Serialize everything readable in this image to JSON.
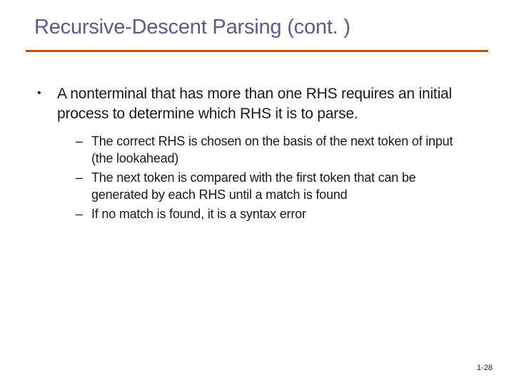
{
  "slide": {
    "title": "Recursive-Descent Parsing (cont. )",
    "bullets": [
      {
        "text": "A nonterminal that has more than one RHS requires an initial process to determine which RHS it is to parse.",
        "sub": [
          "The correct RHS is chosen on the basis of the next token of input (the lookahead)",
          "The next token is compared with the first token that can be generated by each RHS until a match is found",
          "If no match is found, it is a syntax error"
        ]
      }
    ],
    "page_number": "1-28"
  }
}
